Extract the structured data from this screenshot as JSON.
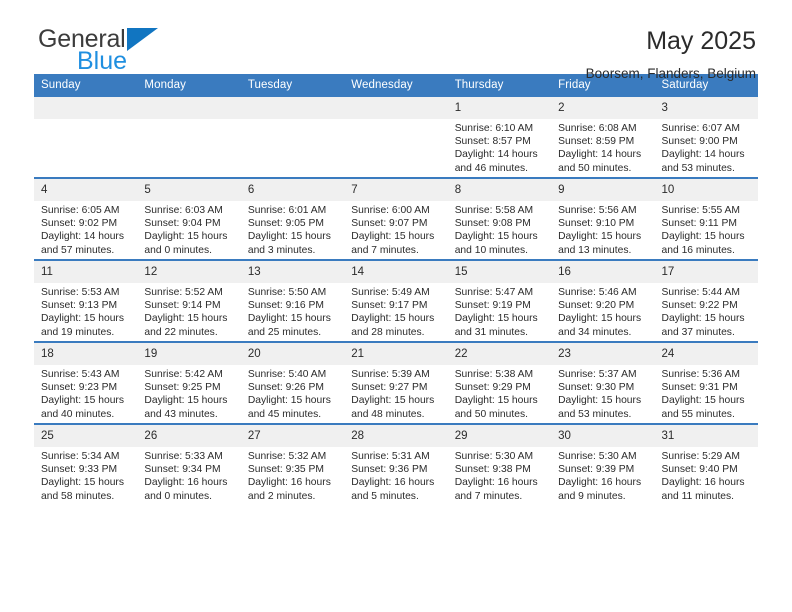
{
  "brand": {
    "name_part1": "General",
    "name_part2": "Blue",
    "triangle_icon": "triangle-icon",
    "accent_color": "#1f8fe0"
  },
  "header": {
    "title": "May 2025",
    "location": "Boorsem, Flanders, Belgium"
  },
  "theme": {
    "header_bg": "#3a7bbf",
    "header_text": "#ffffff",
    "daynum_bg": "#f0f0f0",
    "row_border": "#3a7bbf"
  },
  "weekdays": [
    "Sunday",
    "Monday",
    "Tuesday",
    "Wednesday",
    "Thursday",
    "Friday",
    "Saturday"
  ],
  "weeks": [
    [
      {
        "day": "",
        "sunrise": "",
        "sunset": "",
        "daylight_line1": "",
        "daylight_line2": "",
        "empty": true
      },
      {
        "day": "",
        "sunrise": "",
        "sunset": "",
        "daylight_line1": "",
        "daylight_line2": "",
        "empty": true
      },
      {
        "day": "",
        "sunrise": "",
        "sunset": "",
        "daylight_line1": "",
        "daylight_line2": "",
        "empty": true
      },
      {
        "day": "",
        "sunrise": "",
        "sunset": "",
        "daylight_line1": "",
        "daylight_line2": "",
        "empty": true
      },
      {
        "day": "1",
        "sunrise": "Sunrise: 6:10 AM",
        "sunset": "Sunset: 8:57 PM",
        "daylight_line1": "Daylight: 14 hours",
        "daylight_line2": "and 46 minutes."
      },
      {
        "day": "2",
        "sunrise": "Sunrise: 6:08 AM",
        "sunset": "Sunset: 8:59 PM",
        "daylight_line1": "Daylight: 14 hours",
        "daylight_line2": "and 50 minutes."
      },
      {
        "day": "3",
        "sunrise": "Sunrise: 6:07 AM",
        "sunset": "Sunset: 9:00 PM",
        "daylight_line1": "Daylight: 14 hours",
        "daylight_line2": "and 53 minutes."
      }
    ],
    [
      {
        "day": "4",
        "sunrise": "Sunrise: 6:05 AM",
        "sunset": "Sunset: 9:02 PM",
        "daylight_line1": "Daylight: 14 hours",
        "daylight_line2": "and 57 minutes."
      },
      {
        "day": "5",
        "sunrise": "Sunrise: 6:03 AM",
        "sunset": "Sunset: 9:04 PM",
        "daylight_line1": "Daylight: 15 hours",
        "daylight_line2": "and 0 minutes."
      },
      {
        "day": "6",
        "sunrise": "Sunrise: 6:01 AM",
        "sunset": "Sunset: 9:05 PM",
        "daylight_line1": "Daylight: 15 hours",
        "daylight_line2": "and 3 minutes."
      },
      {
        "day": "7",
        "sunrise": "Sunrise: 6:00 AM",
        "sunset": "Sunset: 9:07 PM",
        "daylight_line1": "Daylight: 15 hours",
        "daylight_line2": "and 7 minutes."
      },
      {
        "day": "8",
        "sunrise": "Sunrise: 5:58 AM",
        "sunset": "Sunset: 9:08 PM",
        "daylight_line1": "Daylight: 15 hours",
        "daylight_line2": "and 10 minutes."
      },
      {
        "day": "9",
        "sunrise": "Sunrise: 5:56 AM",
        "sunset": "Sunset: 9:10 PM",
        "daylight_line1": "Daylight: 15 hours",
        "daylight_line2": "and 13 minutes."
      },
      {
        "day": "10",
        "sunrise": "Sunrise: 5:55 AM",
        "sunset": "Sunset: 9:11 PM",
        "daylight_line1": "Daylight: 15 hours",
        "daylight_line2": "and 16 minutes."
      }
    ],
    [
      {
        "day": "11",
        "sunrise": "Sunrise: 5:53 AM",
        "sunset": "Sunset: 9:13 PM",
        "daylight_line1": "Daylight: 15 hours",
        "daylight_line2": "and 19 minutes."
      },
      {
        "day": "12",
        "sunrise": "Sunrise: 5:52 AM",
        "sunset": "Sunset: 9:14 PM",
        "daylight_line1": "Daylight: 15 hours",
        "daylight_line2": "and 22 minutes."
      },
      {
        "day": "13",
        "sunrise": "Sunrise: 5:50 AM",
        "sunset": "Sunset: 9:16 PM",
        "daylight_line1": "Daylight: 15 hours",
        "daylight_line2": "and 25 minutes."
      },
      {
        "day": "14",
        "sunrise": "Sunrise: 5:49 AM",
        "sunset": "Sunset: 9:17 PM",
        "daylight_line1": "Daylight: 15 hours",
        "daylight_line2": "and 28 minutes."
      },
      {
        "day": "15",
        "sunrise": "Sunrise: 5:47 AM",
        "sunset": "Sunset: 9:19 PM",
        "daylight_line1": "Daylight: 15 hours",
        "daylight_line2": "and 31 minutes."
      },
      {
        "day": "16",
        "sunrise": "Sunrise: 5:46 AM",
        "sunset": "Sunset: 9:20 PM",
        "daylight_line1": "Daylight: 15 hours",
        "daylight_line2": "and 34 minutes."
      },
      {
        "day": "17",
        "sunrise": "Sunrise: 5:44 AM",
        "sunset": "Sunset: 9:22 PM",
        "daylight_line1": "Daylight: 15 hours",
        "daylight_line2": "and 37 minutes."
      }
    ],
    [
      {
        "day": "18",
        "sunrise": "Sunrise: 5:43 AM",
        "sunset": "Sunset: 9:23 PM",
        "daylight_line1": "Daylight: 15 hours",
        "daylight_line2": "and 40 minutes."
      },
      {
        "day": "19",
        "sunrise": "Sunrise: 5:42 AM",
        "sunset": "Sunset: 9:25 PM",
        "daylight_line1": "Daylight: 15 hours",
        "daylight_line2": "and 43 minutes."
      },
      {
        "day": "20",
        "sunrise": "Sunrise: 5:40 AM",
        "sunset": "Sunset: 9:26 PM",
        "daylight_line1": "Daylight: 15 hours",
        "daylight_line2": "and 45 minutes."
      },
      {
        "day": "21",
        "sunrise": "Sunrise: 5:39 AM",
        "sunset": "Sunset: 9:27 PM",
        "daylight_line1": "Daylight: 15 hours",
        "daylight_line2": "and 48 minutes."
      },
      {
        "day": "22",
        "sunrise": "Sunrise: 5:38 AM",
        "sunset": "Sunset: 9:29 PM",
        "daylight_line1": "Daylight: 15 hours",
        "daylight_line2": "and 50 minutes."
      },
      {
        "day": "23",
        "sunrise": "Sunrise: 5:37 AM",
        "sunset": "Sunset: 9:30 PM",
        "daylight_line1": "Daylight: 15 hours",
        "daylight_line2": "and 53 minutes."
      },
      {
        "day": "24",
        "sunrise": "Sunrise: 5:36 AM",
        "sunset": "Sunset: 9:31 PM",
        "daylight_line1": "Daylight: 15 hours",
        "daylight_line2": "and 55 minutes."
      }
    ],
    [
      {
        "day": "25",
        "sunrise": "Sunrise: 5:34 AM",
        "sunset": "Sunset: 9:33 PM",
        "daylight_line1": "Daylight: 15 hours",
        "daylight_line2": "and 58 minutes."
      },
      {
        "day": "26",
        "sunrise": "Sunrise: 5:33 AM",
        "sunset": "Sunset: 9:34 PM",
        "daylight_line1": "Daylight: 16 hours",
        "daylight_line2": "and 0 minutes."
      },
      {
        "day": "27",
        "sunrise": "Sunrise: 5:32 AM",
        "sunset": "Sunset: 9:35 PM",
        "daylight_line1": "Daylight: 16 hours",
        "daylight_line2": "and 2 minutes."
      },
      {
        "day": "28",
        "sunrise": "Sunrise: 5:31 AM",
        "sunset": "Sunset: 9:36 PM",
        "daylight_line1": "Daylight: 16 hours",
        "daylight_line2": "and 5 minutes."
      },
      {
        "day": "29",
        "sunrise": "Sunrise: 5:30 AM",
        "sunset": "Sunset: 9:38 PM",
        "daylight_line1": "Daylight: 16 hours",
        "daylight_line2": "and 7 minutes."
      },
      {
        "day": "30",
        "sunrise": "Sunrise: 5:30 AM",
        "sunset": "Sunset: 9:39 PM",
        "daylight_line1": "Daylight: 16 hours",
        "daylight_line2": "and 9 minutes."
      },
      {
        "day": "31",
        "sunrise": "Sunrise: 5:29 AM",
        "sunset": "Sunset: 9:40 PM",
        "daylight_line1": "Daylight: 16 hours",
        "daylight_line2": "and 11 minutes."
      }
    ]
  ]
}
